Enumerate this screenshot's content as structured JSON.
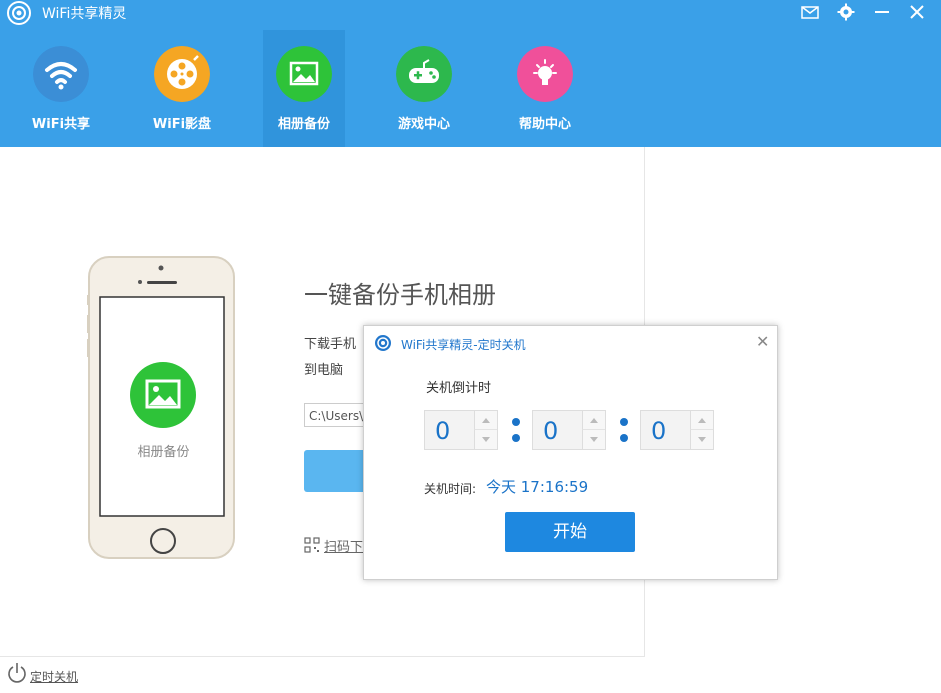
{
  "app": {
    "title": "WiFi共享精灵",
    "accent": "#3aa0e8"
  },
  "window_controls": [
    "mail-icon",
    "gear-icon",
    "minimize-icon",
    "close-icon"
  ],
  "nav": [
    {
      "label": "WiFi共享",
      "icon": "wifi-icon",
      "color": "#3b8ed6"
    },
    {
      "label": "WiFi影盘",
      "icon": "film-reel-icon",
      "color": "#f5a623"
    },
    {
      "label": "相册备份",
      "icon": "photo-icon",
      "color": "#2ec339",
      "active": true
    },
    {
      "label": "游戏中心",
      "icon": "gamepad-icon",
      "color": "#2db84d"
    },
    {
      "label": "帮助中心",
      "icon": "lightbulb-icon",
      "color": "#f0509a"
    }
  ],
  "main": {
    "heading": "一键备份手机相册",
    "desc_line1": "下载手机",
    "desc_line2": "到电脑",
    "path_value": "C:\\Users\\",
    "qr_text": "扫码下载",
    "phone_label": "相册备份"
  },
  "footer": {
    "label": "定时关机"
  },
  "dialog": {
    "title": "WiFi共享精灵-定时关机",
    "countdown_label": "关机倒计时",
    "hours": "0",
    "minutes": "0",
    "seconds": "0",
    "shutdown_label": "关机时间:",
    "shutdown_time": "今天  17:16:59",
    "start_label": "开始"
  }
}
